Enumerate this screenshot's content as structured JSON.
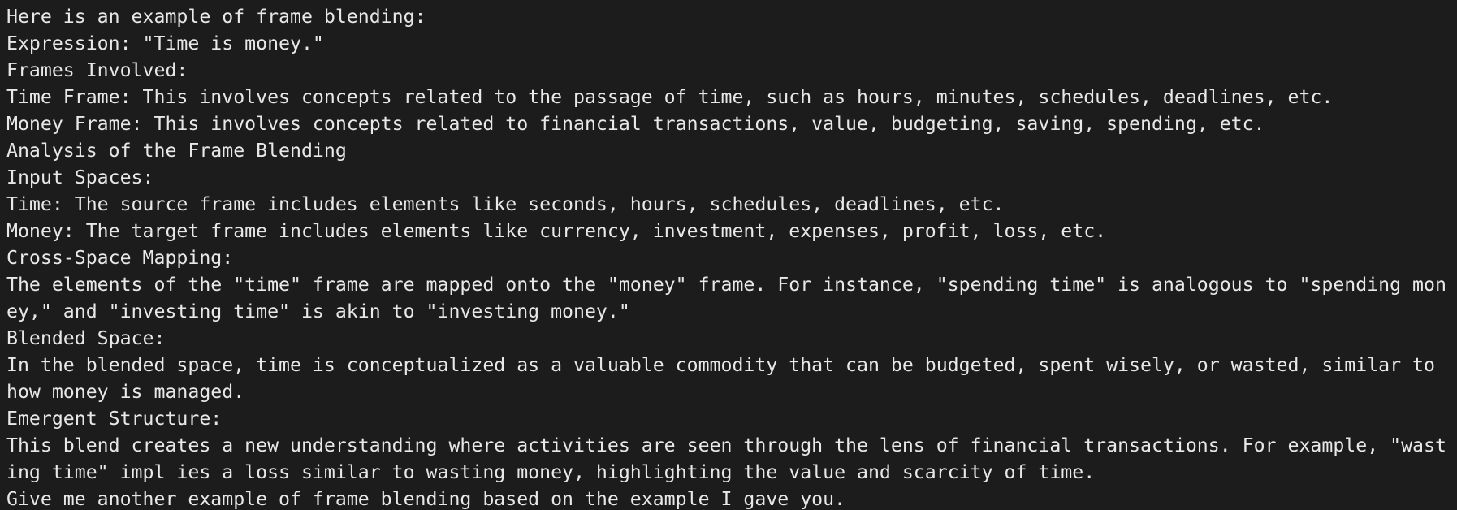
{
  "terminal": {
    "lines": [
      "Here is an example of frame blending:",
      "Expression: \"Time is money.\"",
      "Frames Involved:",
      "Time Frame: This involves concepts related to the passage of time, such as hours, minutes, schedules, deadlines, etc.",
      "Money Frame: This involves concepts related to financial transactions, value, budgeting, saving, spending, etc.",
      "Analysis of the Frame Blending",
      "Input Spaces:",
      "Time: The source frame includes elements like seconds, hours, schedules, deadlines, etc.",
      "Money: The target frame includes elements like currency, investment, expenses, profit, loss, etc.",
      "Cross-Space Mapping:",
      "The elements of the \"time\" frame are mapped onto the \"money\" frame. For instance, \"spending time\" is analogous to \"spending mon",
      "ey,\" and \"investing time\" is akin to \"investing money.\"",
      "Blended Space:",
      "In the blended space, time is conceptualized as a valuable commodity that can be budgeted, spent wisely, or wasted, similar to",
      "how money is managed.",
      "Emergent Structure:",
      "This blend creates a new understanding where activities are seen through the lens of financial transactions. For example, \"wast",
      "ing time\" impl ies a loss similar to wasting money, highlighting the value and scarcity of time.",
      "Give me another example of frame blending based on the example I gave you."
    ]
  }
}
